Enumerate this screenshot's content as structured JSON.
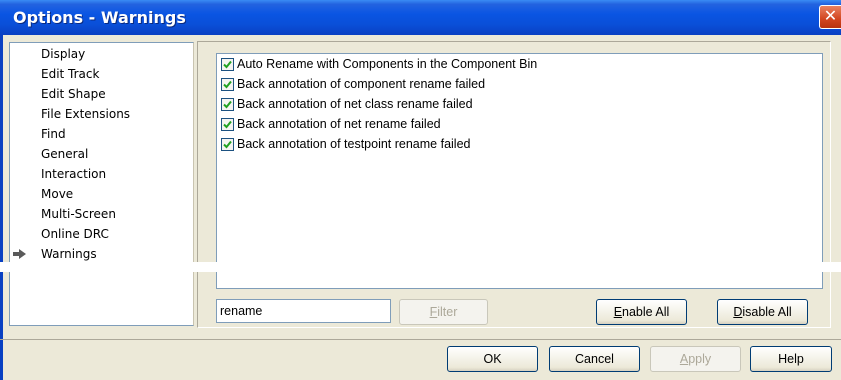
{
  "window": {
    "title": "Options - Warnings",
    "close_glyph": "✕"
  },
  "nav": {
    "items": [
      {
        "label": "Display"
      },
      {
        "label": "Edit Track"
      },
      {
        "label": "Edit Shape"
      },
      {
        "label": "File Extensions"
      },
      {
        "label": "Find"
      },
      {
        "label": "General"
      },
      {
        "label": "Interaction"
      },
      {
        "label": "Move"
      },
      {
        "label": "Multi-Screen"
      },
      {
        "label": "Online DRC"
      },
      {
        "label": "Warnings"
      }
    ],
    "selected": "Warnings"
  },
  "warnings": [
    {
      "label": "Auto Rename with Components in the Component Bin",
      "checked": true
    },
    {
      "label": "Back annotation of component rename failed",
      "checked": true
    },
    {
      "label": "Back annotation of net class rename failed",
      "checked": true
    },
    {
      "label": "Back annotation of net rename failed",
      "checked": true
    },
    {
      "label": "Back annotation of testpoint rename failed",
      "checked": true
    }
  ],
  "filter": {
    "value": "rename",
    "button_label_accel": "F",
    "button_label_rest": "ilter"
  },
  "actions": {
    "enable_all_accel": "E",
    "enable_all_rest": "nable All",
    "disable_all_accel": "D",
    "disable_all_rest": "isable All"
  },
  "footer": {
    "ok": "OK",
    "cancel": "Cancel",
    "apply_accel": "A",
    "apply_rest": "pply",
    "help": "Help"
  },
  "colors": {
    "title_bar": "#0a4fd8",
    "checkbox_check": "#21a121",
    "nav_arrow": "#5a5a5a"
  }
}
